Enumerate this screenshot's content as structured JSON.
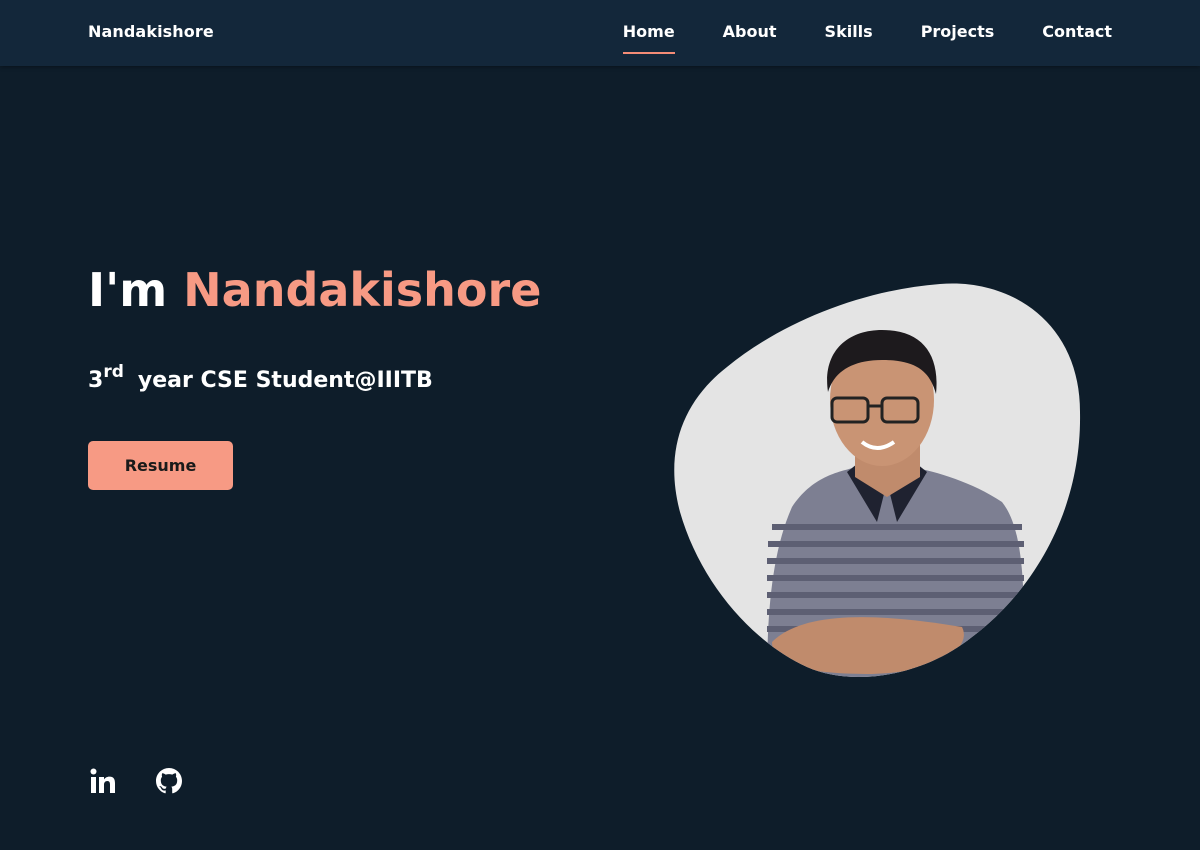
{
  "navbar": {
    "brand": "Nandakishore",
    "links": [
      {
        "label": "Home",
        "active": true
      },
      {
        "label": "About"
      },
      {
        "label": "Skills"
      },
      {
        "label": "Projects"
      },
      {
        "label": "Contact"
      }
    ]
  },
  "hero": {
    "greeting": "I'm",
    "name": "Nandakishore",
    "subtitle_number": "3",
    "subtitle_ordinal": "rd",
    "subtitle_text": "year CSE Student@IIITB",
    "resume_label": "Resume"
  },
  "profile": {
    "image": "portrait-photo"
  },
  "social": {
    "icons": [
      "linkedin-icon",
      "github-icon"
    ]
  },
  "colors": {
    "background": "#0e1d2a",
    "navbar": "#13273a",
    "accent": "#f79a84",
    "blob": "#e4e4e4"
  }
}
